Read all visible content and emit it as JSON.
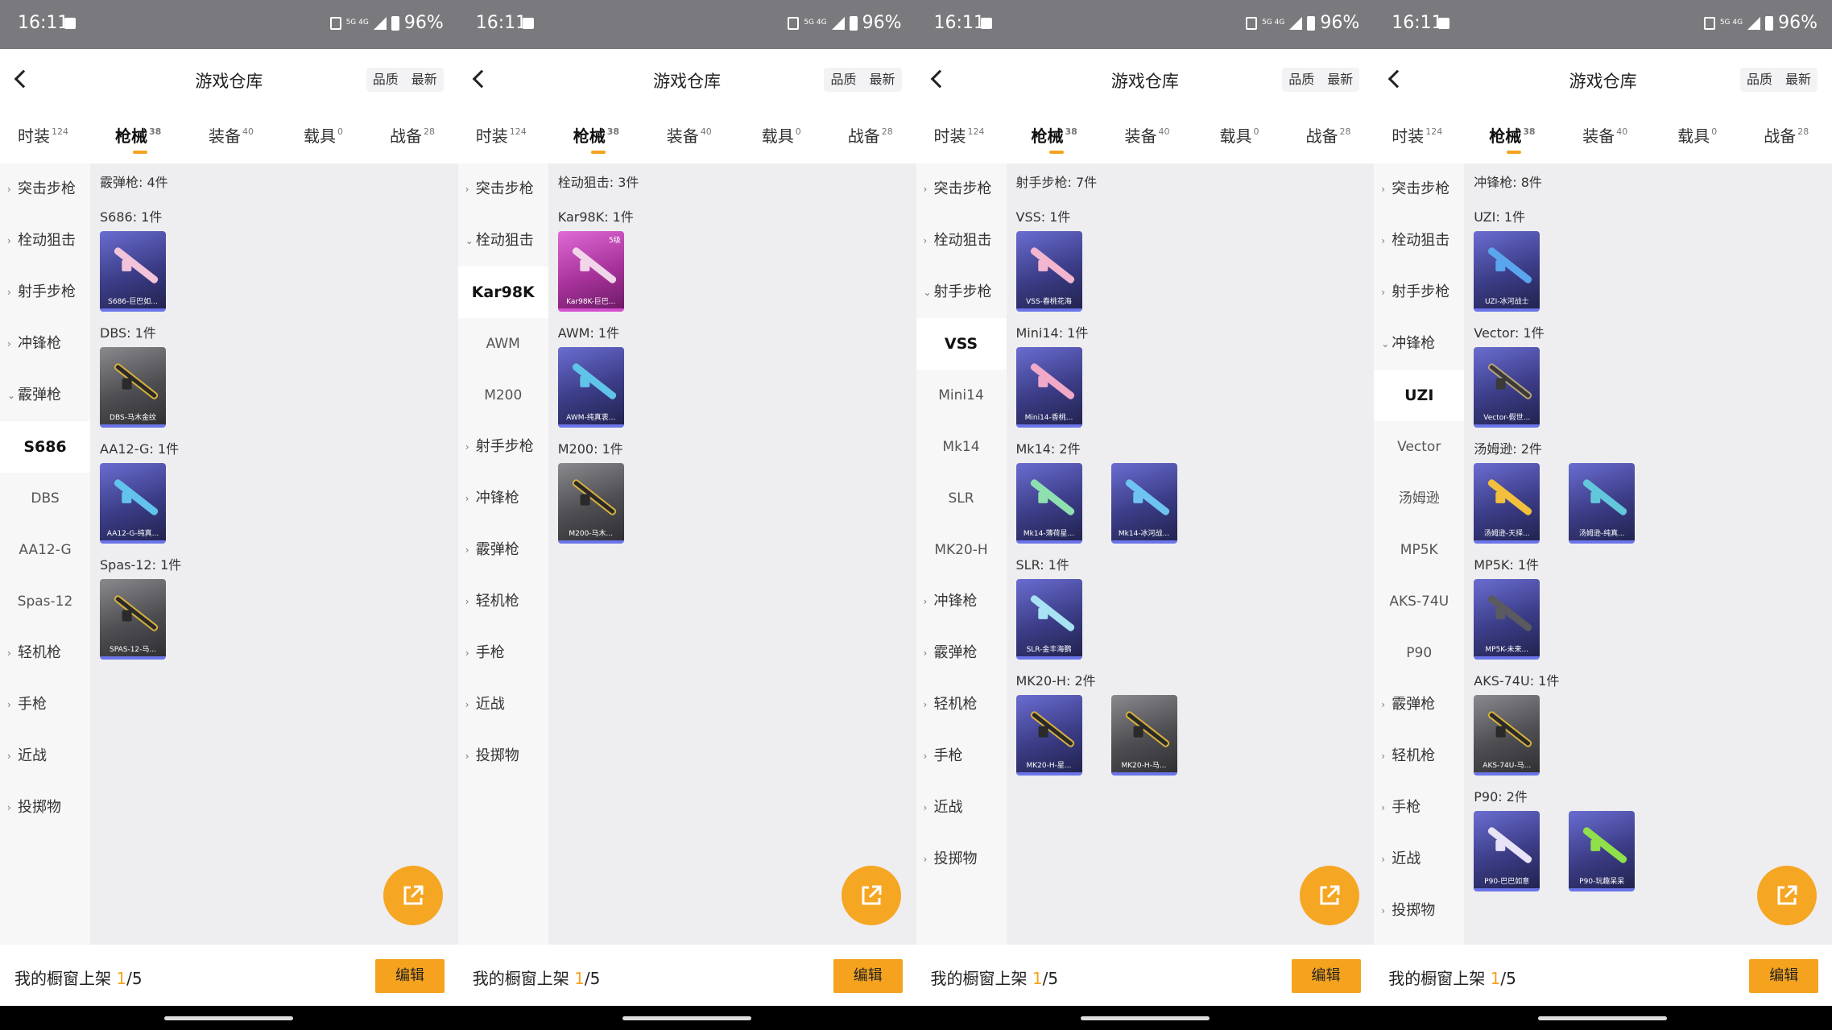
{
  "status": {
    "time": "16:11",
    "battery": "96%",
    "network": "5G 4G"
  },
  "header": {
    "title": "游戏仓库",
    "sort_quality": "品质",
    "sort_newest": "最新"
  },
  "tabs": [
    {
      "label": "时装",
      "count": "124"
    },
    {
      "label": "枪械",
      "count": "38"
    },
    {
      "label": "装备",
      "count": "40"
    },
    {
      "label": "载具",
      "count": "0"
    },
    {
      "label": "战备",
      "count": "28"
    }
  ],
  "footer": {
    "prefix": "我的橱窗上架 ",
    "current": "1",
    "suffix": "/5",
    "edit": "编辑"
  },
  "icons": {
    "back": "chevron-left-icon",
    "share": "share-icon",
    "accent": "#f5a31f"
  },
  "screens": [
    {
      "categories": {
        "assault": "突击步枪",
        "bolt": "栓动狙击",
        "dmr": "射手步枪",
        "smg": "冲锋枪",
        "shotgun": "霰弹枪",
        "lmg": "轻机枪",
        "pistol": "手枪",
        "melee": "近战",
        "throw": "投掷物"
      },
      "subs": [
        "Kar98K",
        "AWM",
        "M200"
      ],
      "group_title": "栓动狙击: 3件",
      "items": [
        {
          "title": "Kar98K: 1件",
          "cards": [
            {
              "label": "Kar98K-巨巴...",
              "badge": "5级"
            }
          ]
        },
        {
          "title": "AWM: 1件",
          "cards": [
            {
              "label": "AWM-纯真衷..."
            }
          ]
        },
        {
          "title": "M200: 1件",
          "cards": [
            {
              "label": "M200-马木..."
            }
          ]
        }
      ]
    },
    {
      "categories": {
        "assault": "突击步枪",
        "bolt": "栓动狙击",
        "dmr": "射手步枪",
        "smg": "冲锋枪",
        "shotgun": "霰弹枪",
        "lmg": "轻机枪",
        "pistol": "手枪",
        "melee": "近战",
        "throw": "投掷物"
      },
      "subs": [
        "VSS",
        "Mini14",
        "Mk14",
        "SLR",
        "MK20-H"
      ],
      "group_title": "射手步枪: 7件",
      "items": [
        {
          "title": "VSS: 1件",
          "cards": [
            {
              "label": "VSS-春桃花海"
            }
          ]
        },
        {
          "title": "Mini14: 1件",
          "cards": [
            {
              "label": "Mini14-香桃..."
            }
          ]
        },
        {
          "title": "Mk14: 2件",
          "cards": [
            {
              "label": "Mk14-薄荷星..."
            },
            {
              "label": "Mk14-冰河战..."
            }
          ]
        },
        {
          "title": "SLR: 1件",
          "cards": [
            {
              "label": "SLR-金丰海鹦"
            }
          ]
        },
        {
          "title": "MK20-H: 2件",
          "cards": [
            {
              "label": "MK20-H-星..."
            },
            {
              "label": "MK20-H-马..."
            }
          ]
        }
      ]
    },
    {
      "categories": {
        "assault": "突击步枪",
        "bolt": "栓动狙击",
        "dmr": "射手步枪",
        "smg": "冲锋枪",
        "shotgun": "霰弹枪",
        "lmg": "轻机枪",
        "pistol": "手枪",
        "melee": "近战",
        "throw": "投掷物"
      },
      "subs": [
        "UZI",
        "Vector",
        "汤姆逊",
        "MP5K",
        "AKS-74U",
        "P90"
      ],
      "group_title": "冲锋枪: 8件",
      "items": [
        {
          "title": "UZI: 1件",
          "cards": [
            {
              "label": "UZI-冰河战士"
            }
          ]
        },
        {
          "title": "Vector: 1件",
          "cards": [
            {
              "label": "Vector-假世..."
            }
          ]
        },
        {
          "title": "汤姆逊: 2件",
          "cards": [
            {
              "label": "汤姆逊-天择..."
            },
            {
              "label": "汤姆逊-纯真..."
            }
          ]
        },
        {
          "title": "MP5K: 1件",
          "cards": [
            {
              "label": "MP5K-未来..."
            }
          ]
        },
        {
          "title": "AKS-74U: 1件",
          "cards": [
            {
              "label": "AKS-74U-马..."
            }
          ]
        },
        {
          "title": "P90: 2件",
          "cards": [
            {
              "label": "P90-巴巴如意"
            },
            {
              "label": "P90-玩趣呆呆"
            }
          ]
        }
      ]
    },
    {
      "categories": {
        "assault": "突击步枪",
        "bolt": "栓动狙击",
        "dmr": "射手步枪",
        "smg": "冲锋枪",
        "shotgun": "霰弹枪",
        "lmg": "轻机枪",
        "pistol": "手枪",
        "melee": "近战",
        "throw": "投掷物"
      },
      "subs": [
        "S686",
        "DBS",
        "AA12-G",
        "Spas-12"
      ],
      "group_title": "霰弹枪: 4件",
      "items": [
        {
          "title": "S686: 1件",
          "cards": [
            {
              "label": "S686-巨巴如..."
            }
          ]
        },
        {
          "title": "DBS: 1件",
          "cards": [
            {
              "label": "DBS-马木金纹"
            }
          ]
        },
        {
          "title": "AA12-G: 1件",
          "cards": [
            {
              "label": "AA12-G-纯真..."
            }
          ]
        },
        {
          "title": "Spas-12: 1件",
          "cards": [
            {
              "label": "SPAS-12-马..."
            }
          ]
        }
      ]
    }
  ]
}
